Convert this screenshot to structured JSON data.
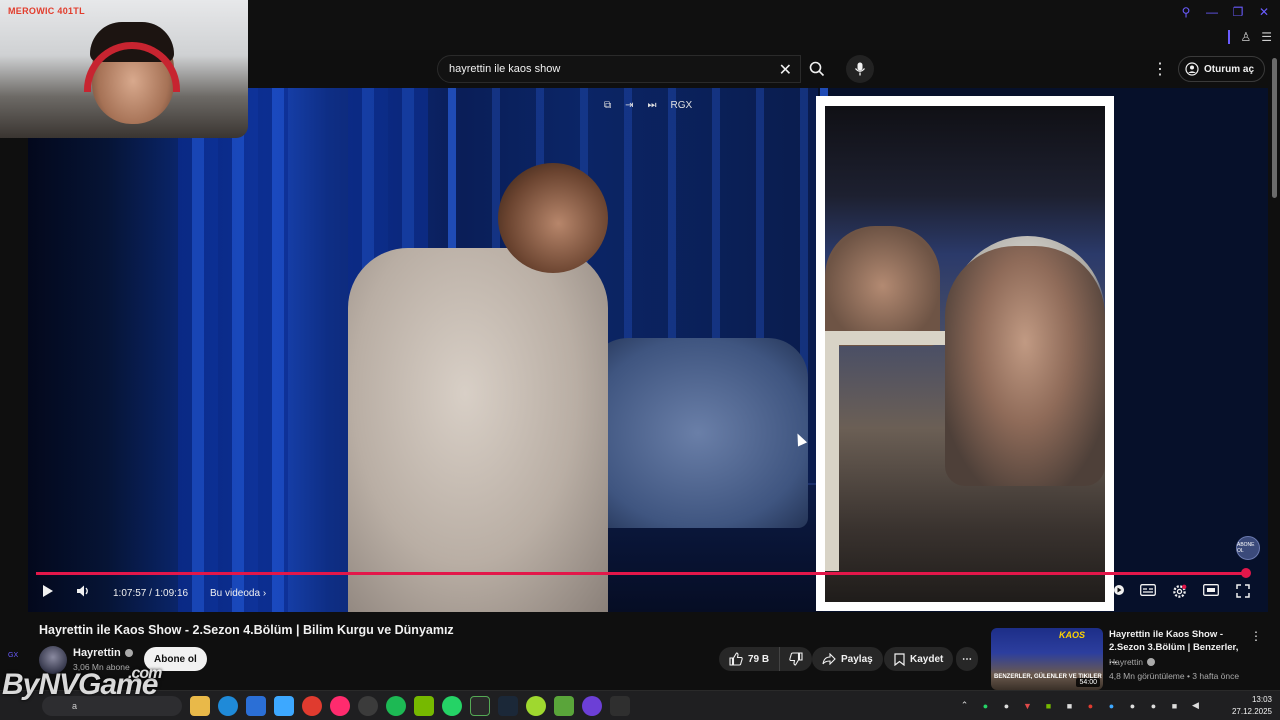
{
  "browser": {
    "window_controls": [
      "search-icon",
      "minimize-icon",
      "restore-icon",
      "close-icon"
    ]
  },
  "header": {
    "search_value": "hayrettin ile kaos show",
    "signin_label": "Oturum aç"
  },
  "webcam": {
    "overlay_text": "MEROWIC 401TL"
  },
  "player": {
    "top_icons": [
      "miniplayer-icon",
      "exit-icon",
      "skip-icon"
    ],
    "top_label": "RGX",
    "time": "1:07:57 / 1:09:16",
    "chapter": "Bu videoda",
    "progress": 0.9818,
    "avatar_badge": "ABONE OL",
    "colors": {
      "progress": "#e3174a"
    }
  },
  "video": {
    "title": "Hayrettin ile Kaos Show - 2.Sezon 4.Bölüm | Bilim Kurgu ve Dünyamız",
    "channel": "Hayrettin",
    "subscribers": "3,06 Mn abone",
    "subscribe_label": "Abone ol",
    "likes": "79 B",
    "share_label": "Paylaş",
    "save_label": "Kaydet",
    "gx_label": "GX"
  },
  "recommendation": {
    "title": "Hayrettin ile Kaos Show - 2.Sezon 3.Bölüm | Benzerler, ...",
    "channel": "Hayrettin",
    "meta": "4,8 Mn görüntüleme • 3 hafta önce",
    "duration": "54:00",
    "thumb_brand": "KAOS",
    "thumb_caption": "BENZERLER, GÜLENLER VE TIKILER"
  },
  "taskbar": {
    "search_placeholder": "a",
    "time": "13:03",
    "date": "27.12.2025"
  },
  "watermark": {
    "text": "ByNVGame",
    "suffix": ".com"
  }
}
